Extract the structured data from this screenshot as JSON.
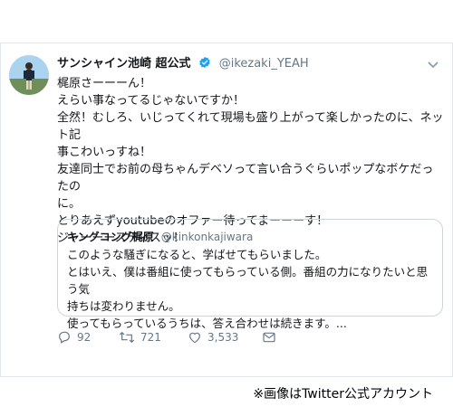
{
  "tweet": {
    "display_name": "サンシャイン池崎 超公式",
    "handle": "@ikezaki_YEAH",
    "lines": [
      "梶原さーーーん！",
      "えらい事なってるじゃないですか！",
      "全然！むしろ、いじってくれて現場も盛り上がって楽しかったのに、ネット記",
      "事こわいっすね！",
      "友達同士でお前の母ちゃんデベソって言い合うぐらいポップなボケだったの",
      "に。",
      "とりあえずyoutubeのオファー待ってまーーーす！",
      "ジャーーースティスッ！"
    ]
  },
  "quoted": {
    "display_name": "キングコング梶原",
    "handle": "@kinkonkajiwara",
    "lines": [
      "このような騒ぎになると、学ばせてもらいました。",
      "とはいえ、僕は番組に使ってもらっている側。番組の力になりたいと思う気",
      "持ちは変わりません。",
      "使ってもらっているうちは、答え合わせは続きます。..."
    ]
  },
  "actions": {
    "reply_count": "92",
    "retweet_count": "721",
    "like_count": "3,533"
  },
  "caption": "※画像はTwitter公式アカウント",
  "colors": {
    "verified": "#1da1f2",
    "muted": "#657786",
    "border": "#e1e8ed"
  }
}
